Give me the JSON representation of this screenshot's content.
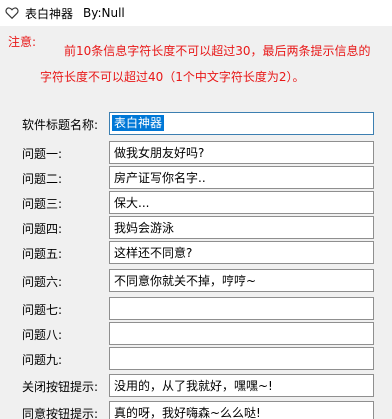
{
  "window": {
    "title": "表白神器",
    "subtitle": "By:Null"
  },
  "notice": {
    "header": "注意:",
    "line1": "前10条信息字符长度不可以超过30，最后两条提示信息的",
    "line2": "字符长度不可以超过40（1个中文字符长度为2）。"
  },
  "fields": [
    {
      "label": "软件标题名称:",
      "value": "表白神器"
    },
    {
      "label": "问题一:",
      "value": "做我女朋友好吗?"
    },
    {
      "label": "问题二:",
      "value": "房产证写你名字.."
    },
    {
      "label": "问题三:",
      "value": "保大..."
    },
    {
      "label": "问题四:",
      "value": "我妈会游泳"
    },
    {
      "label": "问题五:",
      "value": "这样还不同意?"
    },
    {
      "label": "问题六:",
      "value": "不同意你就关不掉，哼哼~"
    },
    {
      "label": "问题七:",
      "value": ""
    },
    {
      "label": "问题八:",
      "value": ""
    },
    {
      "label": "问题九:",
      "value": ""
    },
    {
      "label": "关闭按钮提示:",
      "value": "没用的，从了我就好，嘿嘿~!"
    },
    {
      "label": "同意按钮提示:",
      "value": "真的呀，我好嗨森~么么哒!"
    }
  ],
  "colors": {
    "notice_text": "#e81818",
    "selection": "#0078d7",
    "background": "#f0f0f0"
  },
  "icons": {
    "title": "heart-icon"
  }
}
